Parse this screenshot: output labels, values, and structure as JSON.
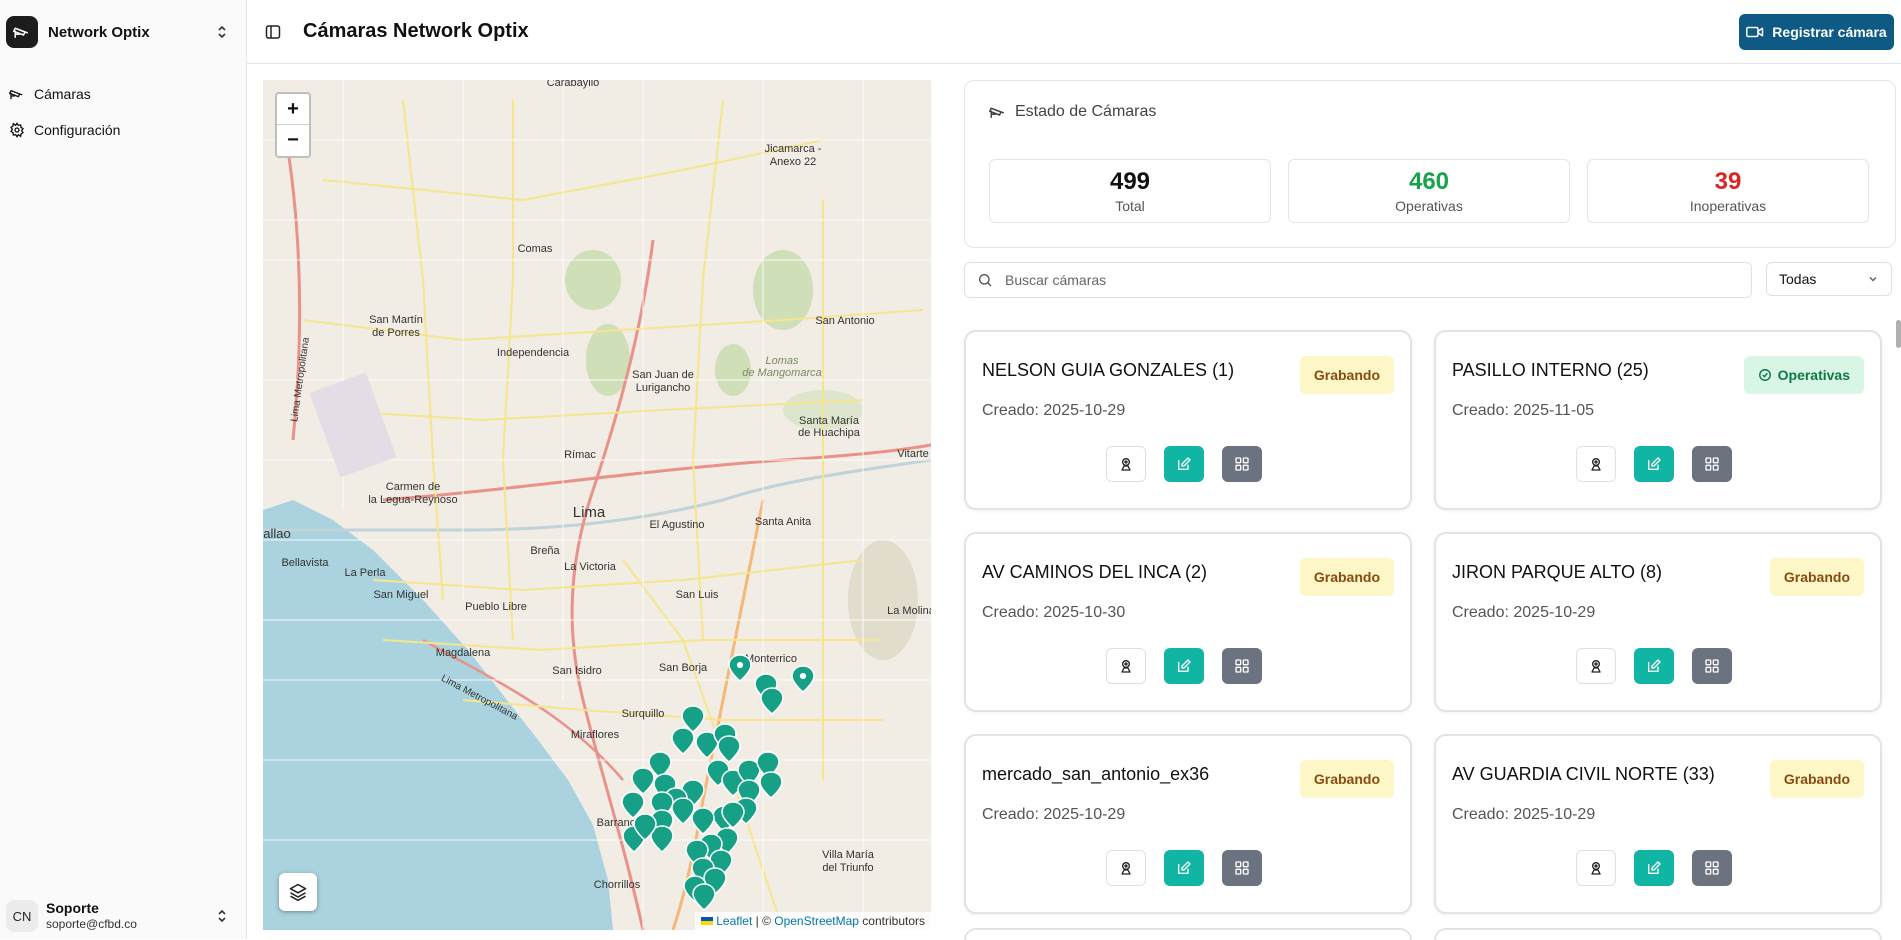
{
  "sidebar": {
    "brand": "Network Optix",
    "nav": [
      {
        "label": "Cámaras",
        "icon": "cctv-icon"
      },
      {
        "label": "Configuración",
        "icon": "gear-icon"
      }
    ],
    "user": {
      "initials": "CN",
      "name": "Soporte",
      "email": "soporte@cfbd.co"
    }
  },
  "header": {
    "title": "Cámaras Network Optix",
    "register_label": "Registrar cámara"
  },
  "map": {
    "zoom_in": "+",
    "zoom_out": "−",
    "attribution": {
      "leaflet": "Leaflet",
      "sep": " | © ",
      "osm": "OpenStreetMap",
      "suffix": " contributors"
    },
    "places": [
      "Carabayllo",
      "Comas",
      "San Martín de Porres",
      "Independencia",
      "San Juan de Lurigancho",
      "San Antonio",
      "Lomas de Mangomarca",
      "Santa María de Huachipa",
      "Jicamarca - Anexo 22",
      "Rímac",
      "Carmen de la Legua-Reynoso",
      "Lima",
      "El Agustino",
      "Santa Anita",
      "Vitarte",
      "Callao",
      "Bellavista",
      "La Perla",
      "San Miguel",
      "Breña",
      "La Victoria",
      "Pueblo Libre",
      "San Luis",
      "Magdalena",
      "San Isidro",
      "San Borja",
      "Monterrico",
      "Surquillo",
      "Miraflores",
      "La Molina",
      "Barranco",
      "Chorrillos",
      "Villa María del Triunfo",
      "Lima Metropolitana"
    ],
    "marker_color": "#16a085"
  },
  "stats": {
    "title": "Estado de Cámaras",
    "total": {
      "value": "499",
      "label": "Total",
      "color": "#111111"
    },
    "operative": {
      "value": "460",
      "label": "Operativas",
      "color": "#16a34a"
    },
    "inoperative": {
      "value": "39",
      "label": "Inoperativas",
      "color": "#dc2626"
    }
  },
  "search": {
    "placeholder": "Buscar cámaras",
    "value": ""
  },
  "filter": {
    "selected": "Todas"
  },
  "cameras": [
    {
      "name": "NELSON GUIA GONZALES (1)",
      "created": "Creado: 2025-10-29",
      "status": "Grabando"
    },
    {
      "name": "PASILLO INTERNO (25)",
      "created": "Creado: 2025-11-05",
      "status": "Operativas"
    },
    {
      "name": "AV CAMINOS DEL INCA (2)",
      "created": "Creado: 2025-10-30",
      "status": "Grabando"
    },
    {
      "name": "JIRON PARQUE ALTO (8)",
      "created": "Creado: 2025-10-29",
      "status": "Grabando"
    },
    {
      "name": "mercado_san_antonio_ex36",
      "created": "Creado: 2025-10-29",
      "status": "Grabando"
    },
    {
      "name": "AV GUARDIA CIVIL NORTE (33)",
      "created": "Creado: 2025-10-29",
      "status": "Grabando"
    }
  ],
  "colors": {
    "primary": "#0e5a84",
    "edit": "#11b5a3",
    "grid": "#6b7280",
    "recording_bg": "#fdf6c6",
    "ok_bg": "#d8f5e6"
  }
}
